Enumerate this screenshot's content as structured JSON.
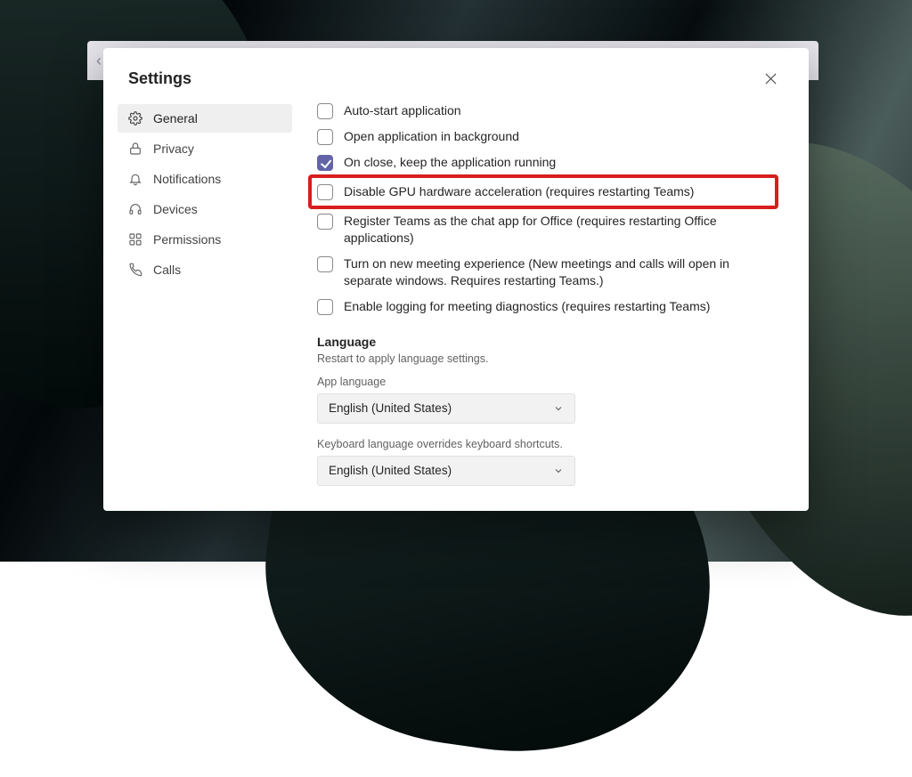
{
  "modal": {
    "title": "Settings"
  },
  "sidebar": {
    "items": [
      {
        "label": "General",
        "icon": "gear-icon",
        "active": true
      },
      {
        "label": "Privacy",
        "icon": "lock-icon",
        "active": false
      },
      {
        "label": "Notifications",
        "icon": "bell-icon",
        "active": false
      },
      {
        "label": "Devices",
        "icon": "headset-icon",
        "active": false
      },
      {
        "label": "Permissions",
        "icon": "grid-icon",
        "active": false
      },
      {
        "label": "Calls",
        "icon": "phone-icon",
        "active": false
      }
    ]
  },
  "options": [
    {
      "label": "Auto-start application",
      "checked": false
    },
    {
      "label": "Open application in background",
      "checked": false
    },
    {
      "label": "On close, keep the application running",
      "checked": true
    },
    {
      "label": "Disable GPU hardware acceleration (requires restarting Teams)",
      "checked": false,
      "highlighted": true
    },
    {
      "label": "Register Teams as the chat app for Office (requires restarting Office applications)",
      "checked": false
    },
    {
      "label": "Turn on new meeting experience (New meetings and calls will open in separate windows. Requires restarting Teams.)",
      "checked": false
    },
    {
      "label": "Enable logging for meeting diagnostics (requires restarting Teams)",
      "checked": false
    }
  ],
  "language": {
    "section_title": "Language",
    "section_sub": "Restart to apply language settings.",
    "app_label": "App language",
    "app_value": "English (United States)",
    "kb_label": "Keyboard language overrides keyboard shortcuts.",
    "kb_value": "English (United States)"
  },
  "colors": {
    "accent": "#6264a7",
    "highlight": "#d81e1e"
  }
}
